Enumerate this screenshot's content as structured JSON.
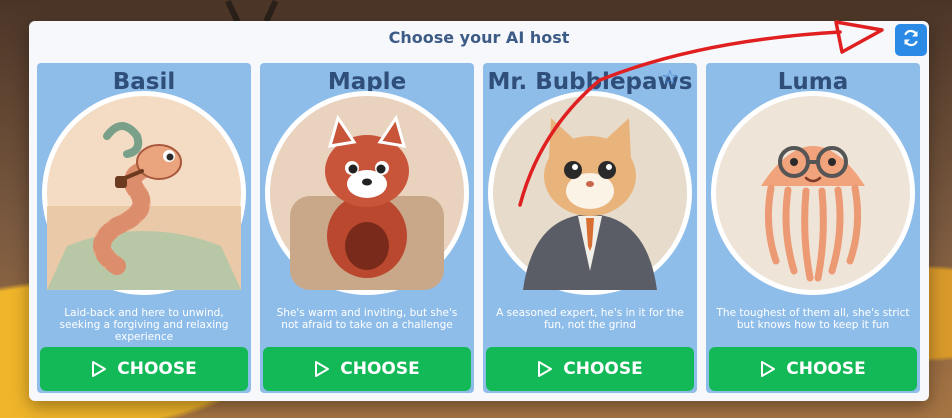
{
  "header": {
    "title": "Choose your AI host",
    "refresh_icon": "refresh-icon"
  },
  "hosts": [
    {
      "name": "Basil",
      "description": "Laid-back and here to unwind, seeking a forgiving and relaxing experience",
      "button_label": "CHOOSE",
      "portrait": "snake-with-pipe-illustration"
    },
    {
      "name": "Maple",
      "description": "She's warm and inviting, but she's not afraid to take on a challenge",
      "button_label": "CHOOSE",
      "portrait": "red-panda-in-armchair-illustration"
    },
    {
      "name": "Mr. Bubblepaws",
      "description": "A seasoned expert, he's in it for the fun, not the grind",
      "button_label": "CHOOSE",
      "portrait": "cat-in-suit-illustration"
    },
    {
      "name": "Luma",
      "description": "The toughest of them all, she's strict but knows how to keep it fun",
      "button_label": "CHOOSE",
      "portrait": "jellyfish-with-glasses-illustration"
    }
  ],
  "colors": {
    "card_bg": "#8fbdea",
    "button_green": "#13b957",
    "title_text": "#3c5b86",
    "refresh_blue": "#2a8ae6",
    "annotation_red": "#e02020"
  }
}
